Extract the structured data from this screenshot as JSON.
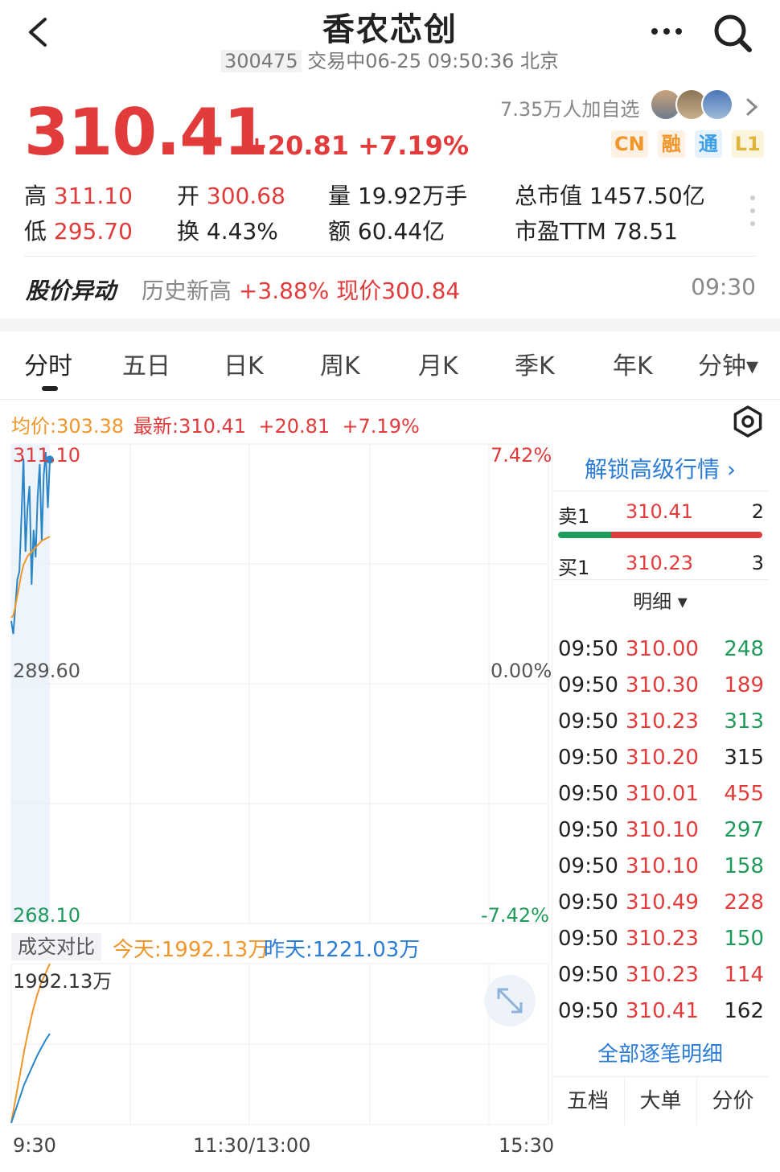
{
  "header": {
    "title": "香农芯创",
    "code": "300475",
    "status": "交易中06-25 09:50:36 北京"
  },
  "quote": {
    "price": "310.41",
    "change": "+20.81",
    "change_pct": "+7.19%",
    "followers": "7.35万人加自选",
    "badges": [
      "CN",
      "融",
      "通",
      "L1"
    ],
    "badge_colors": [
      "#f0962a",
      "#f0962a",
      "#3a9ee6",
      "#e0b53a"
    ]
  },
  "stats": {
    "high_label": "高",
    "high": "311.10",
    "low_label": "低",
    "low": "295.70",
    "open_label": "开",
    "open": "300.68",
    "turnover_label": "换",
    "turnover": "4.43%",
    "volume_label": "量",
    "volume": "19.92万手",
    "amount_label": "额",
    "amount": "60.44亿",
    "mcap_label": "总市值",
    "mcap": "1457.50亿",
    "pe_label": "市盈TTM",
    "pe": "78.51"
  },
  "alert": {
    "title": "股价异动",
    "text_label": "历史新高",
    "text_value": "+3.88% 现价300.84",
    "time": "09:30"
  },
  "tabs": [
    "分时",
    "五日",
    "日K",
    "周K",
    "月K",
    "季K",
    "年K",
    "分钟▾"
  ],
  "chart_header": {
    "avg": "均价:303.38",
    "latest": "最新:310.41",
    "chg": "+20.81",
    "pct": "+7.19%"
  },
  "chart_data": {
    "type": "line",
    "price_axis": {
      "top": "311.10",
      "mid": "289.60",
      "bottom": "268.10"
    },
    "pct_axis": {
      "top": "7.42%",
      "mid": "0.00%",
      "bottom": "-7.42%"
    },
    "ylim": [
      268.1,
      311.1
    ],
    "time_labels": [
      "9:30",
      "11:30/13:00",
      "15:30"
    ],
    "series": [
      {
        "values": [
          295.7,
          294.5,
          297.0,
          299.5,
          300.2,
          305.0,
          310.5,
          302.0,
          306.0,
          308.0,
          299.0,
          304.0,
          301.5,
          307.0,
          310.0,
          303.0,
          309.0,
          311.1,
          306.0,
          310.41
        ]
      },
      {
        "values": [
          296.0,
          296.2,
          297.0,
          298.0,
          299.0,
          300.0,
          300.8,
          301.2,
          301.6,
          301.8,
          302.0,
          302.2,
          302.4,
          302.6,
          302.8,
          303.0,
          303.1,
          303.2,
          303.3,
          303.38
        ]
      }
    ],
    "line_colors": [
      "#2a86c8",
      "#f0962a"
    ],
    "volume": {
      "label": "成交对比",
      "today": "今天:1992.13万",
      "yesterday": "昨天:1221.03万",
      "max_label": "1992.13万",
      "today_values": [
        0,
        15,
        30,
        45,
        58,
        70,
        80,
        88,
        94,
        100
      ],
      "yesterday_values": [
        0,
        8,
        16,
        24,
        30,
        36,
        42,
        47,
        52,
        56
      ]
    }
  },
  "order_book": {
    "unlock": "解锁高级行情",
    "sell": {
      "label": "卖1",
      "price": "310.41",
      "qty": "2"
    },
    "buy": {
      "label": "买1",
      "price": "310.23",
      "qty": "3"
    },
    "buy_fraction": 0.26,
    "detail_toggle": "明细 ▾",
    "ticks": [
      {
        "time": "09:50",
        "price": "310.00",
        "qty": "248",
        "side": "green"
      },
      {
        "time": "09:50",
        "price": "310.30",
        "qty": "189",
        "side": "red"
      },
      {
        "time": "09:50",
        "price": "310.23",
        "qty": "313",
        "side": "green"
      },
      {
        "time": "09:50",
        "price": "310.20",
        "qty": "315",
        "side": "dark"
      },
      {
        "time": "09:50",
        "price": "310.01",
        "qty": "455",
        "side": "red"
      },
      {
        "time": "09:50",
        "price": "310.10",
        "qty": "297",
        "side": "green"
      },
      {
        "time": "09:50",
        "price": "310.10",
        "qty": "158",
        "side": "green"
      },
      {
        "time": "09:50",
        "price": "310.49",
        "qty": "228",
        "side": "red"
      },
      {
        "time": "09:50",
        "price": "310.23",
        "qty": "150",
        "side": "green"
      },
      {
        "time": "09:50",
        "price": "310.23",
        "qty": "114",
        "side": "red"
      },
      {
        "time": "09:50",
        "price": "310.41",
        "qty": "162",
        "side": "dark"
      }
    ],
    "all_ticks": "全部逐笔明细",
    "bottom_tabs": [
      "五档",
      "大单",
      "分价"
    ]
  }
}
